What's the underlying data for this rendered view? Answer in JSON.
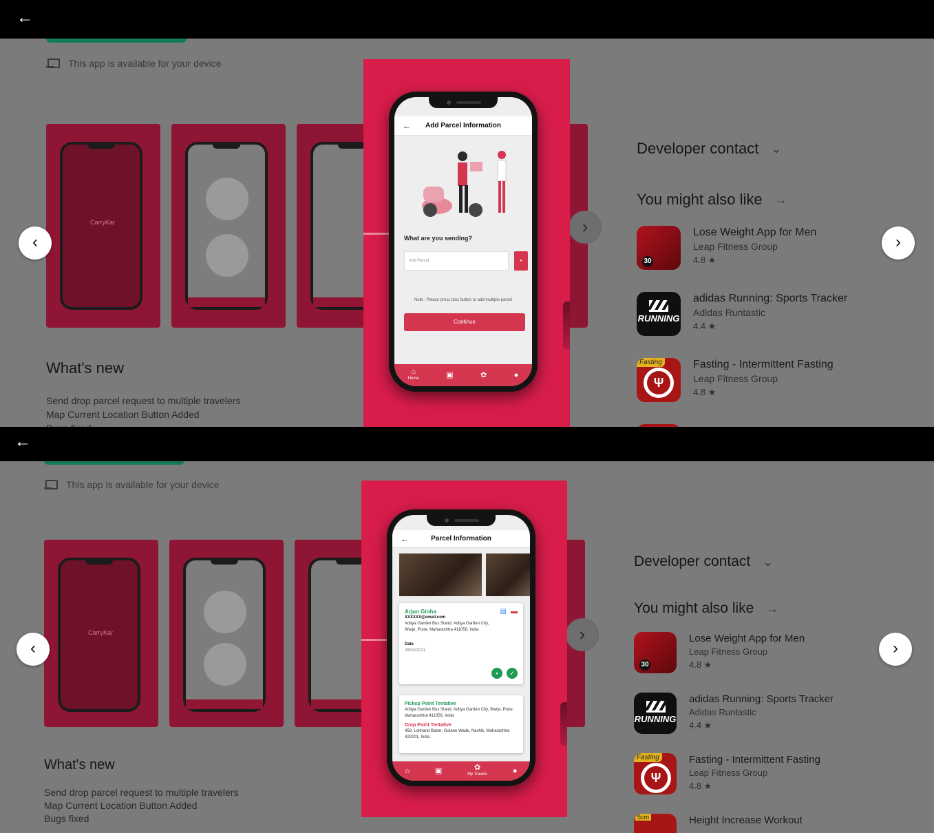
{
  "availability_text": "This app is available for your device",
  "whats_new": {
    "title": "What's new",
    "lines": [
      "Send drop parcel request to multiple travelers",
      "Map Current Location Button Added",
      "Bugs fixed"
    ]
  },
  "developer_contact": "Developer contact",
  "you_might_also_like": "You might also like",
  "apps": [
    {
      "name": "Lose Weight App for Men",
      "developer": "Leap Fitness Group",
      "rating": "4.8 ★"
    },
    {
      "name": "adidas Running: Sports Tracker",
      "developer": "Adidas Runtastic",
      "rating": "4.4 ★"
    },
    {
      "name": "Fasting - Intermittent Fasting",
      "developer": "Leap Fitness Group",
      "rating": "4.8 ★"
    },
    {
      "name": "Height Increase Workout",
      "developer": "",
      "rating": ""
    }
  ],
  "thumb_logo": "CarryKar",
  "screen1": {
    "title": "Add Parcel Information",
    "question": "What are you sending?",
    "input_placeholder": "Add Parcel",
    "plus": "+",
    "note": "Note : Please press plus button to add multiple parcel",
    "button": "Continue",
    "nav_home": "Home"
  },
  "screen2": {
    "title": "Parcel Information",
    "sender_name": "Arjun Ginha",
    "sender_email": "XXXXXX@email.com",
    "sender_address": "Aditya Garden Bus Stand, Aditya Garden City, Warje, Pune, Maharashtra 411058, India",
    "date_label": "Date",
    "date_value": "29/02/2021",
    "pickup_label": "Pickup Point Tentative",
    "pickup_address": "Aditya Garden Bus Stand, Aditya Garden City, Warje, Pune, Maharashtra 411058, India",
    "drop_label": "Drop Point Tentative",
    "drop_address": "458, Lokhand Bazar, Gotane Wade, Nashik, Maharashtra 422001, India",
    "nav_travels": "My Travels"
  },
  "icons": {
    "back": "←",
    "prev": "‹",
    "next": "›",
    "chevron_down": "⌄",
    "arrow_right": "→",
    "home": "⌂",
    "parcel": "▣",
    "travel": "✿",
    "user": "●",
    "chat": "▪",
    "check": "✓",
    "car": "▬",
    "doc": "▤"
  },
  "colors": {
    "accent": "#d91d4b",
    "brand_green": "#1e9a54",
    "button_red": "#d4354f"
  }
}
